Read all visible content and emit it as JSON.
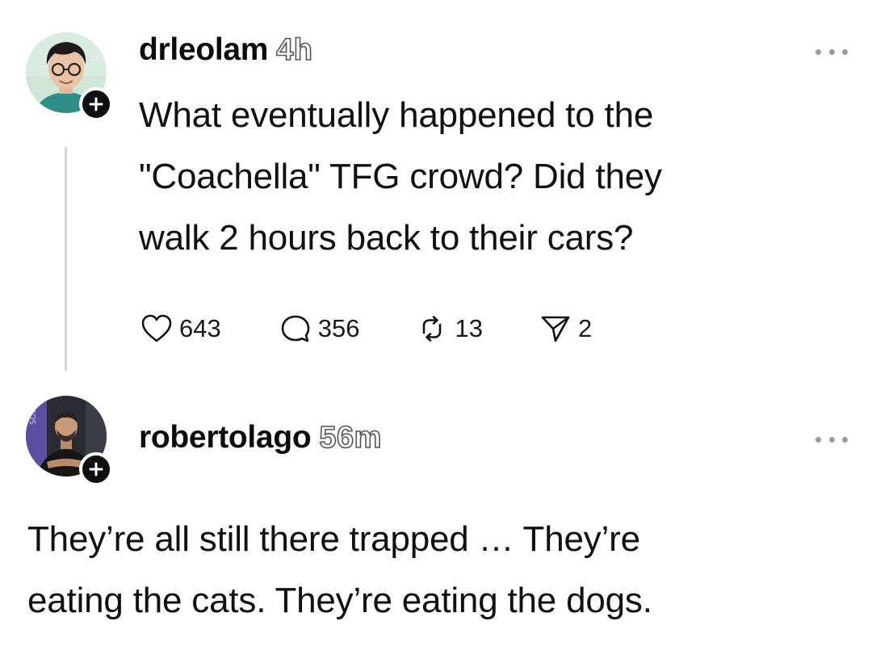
{
  "posts": [
    {
      "username": "drleolam",
      "time": "4h",
      "text_lines": [
        "What eventually happened to the",
        "\"Coachella\" TFG crowd? Did they",
        "walk 2 hours back to their cars?"
      ],
      "actions": {
        "likes": "643",
        "replies": "356",
        "reposts": "13",
        "shares": "2"
      }
    },
    {
      "username": "robertolago",
      "time": "56m",
      "text_lines": [
        "They’re all still there trapped … They’re",
        "eating the cats. They’re eating the dogs."
      ]
    }
  ],
  "icons": {
    "like": "heart-icon",
    "reply": "speech-bubble-icon",
    "repost": "repost-arrows-icon",
    "share": "paper-plane-icon",
    "follow": "plus-icon",
    "more": "ellipsis-icon"
  },
  "colors": {
    "text": "#111111",
    "muted": "#9a9a9a",
    "thread_line": "#d6d6d6",
    "badge": "#101010"
  }
}
